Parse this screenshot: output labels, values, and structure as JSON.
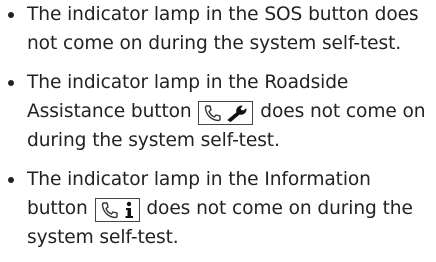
{
  "items": [
    {
      "text": "The indicator lamp in the SOS button does not come on during the system self-test."
    },
    {
      "text_before": "The indicator lamp in the Roadside Assistance button",
      "icon": "phone-wrench-icon",
      "text_after": "does not come on during the system self-test."
    },
    {
      "text_before": "The indicator lamp in the Information button",
      "icon": "phone-info-icon",
      "text_after": "does not come on during the system self-test."
    }
  ]
}
